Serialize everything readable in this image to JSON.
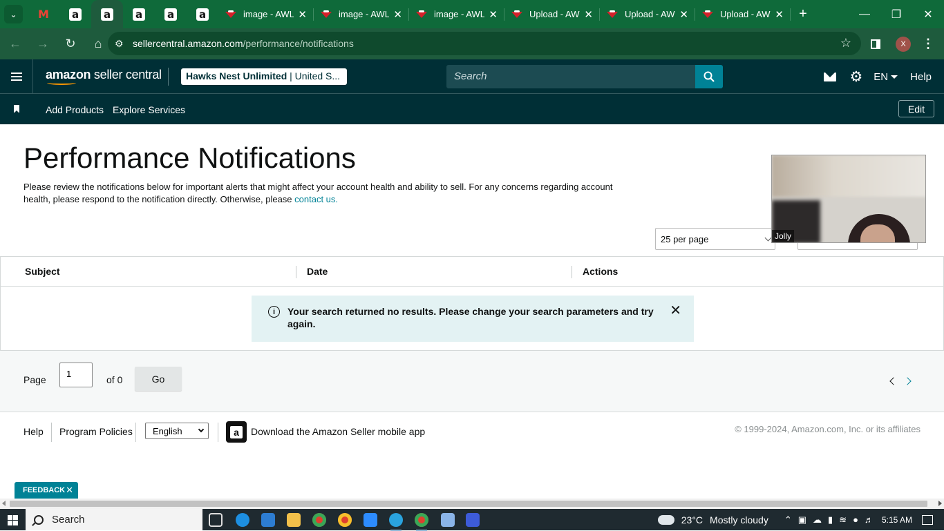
{
  "browser": {
    "tabs": [
      {
        "title": "image - AWL"
      },
      {
        "title": "image - AWL"
      },
      {
        "title": "image - AWL"
      },
      {
        "title": "Upload - AW"
      },
      {
        "title": "Upload - AW"
      },
      {
        "title": "Upload - AW"
      }
    ],
    "pinned_letter": "a",
    "new_tab": "+",
    "url_host": "sellercentral.amazon.com",
    "url_path": "/performance/notifications",
    "profile_initial": "X"
  },
  "header": {
    "logo_brand": "amazon",
    "logo_product": " seller central",
    "account_name": "Hawks Nest Unlimited",
    "account_region": " | United S...",
    "search_placeholder": "Search",
    "language": "EN",
    "help": "Help"
  },
  "nav": {
    "items": [
      "Add Products",
      "Explore Services"
    ],
    "edit_label": "Edit"
  },
  "page": {
    "title": "Performance Notifications",
    "intro": "Please review the notifications below for important alerts that might affect your account health and ability to sell. For any concerns regarding account health, please respond to the notification directly. Otherwise, please ",
    "contact_link": "contact us.",
    "per_page": "25 per page",
    "video_name": "Jolly"
  },
  "table": {
    "columns": [
      "Subject",
      "Date",
      "Actions"
    ],
    "alert_message": "Your search returned no results. Please change your search parameters and try again."
  },
  "pager": {
    "page_label": "Page",
    "page_value": "1",
    "of_label": "of 0",
    "go_label": "Go"
  },
  "footer": {
    "help": "Help",
    "policies": "Program Policies",
    "language": "English",
    "app_text": "Download the Amazon Seller mobile app",
    "app_icon_letter": "a",
    "copyright": "© 1999-2024, Amazon.com, Inc. or its affiliates"
  },
  "feedback_label": "FEEDBACK",
  "taskbar": {
    "search_label": "Search",
    "temperature": "23°C",
    "weather": "Mostly cloudy",
    "time": "5:15 AM"
  },
  "colors": {
    "header_bg": "#002f36",
    "accent_teal": "#008296",
    "chrome_green": "#0f6a3a"
  }
}
